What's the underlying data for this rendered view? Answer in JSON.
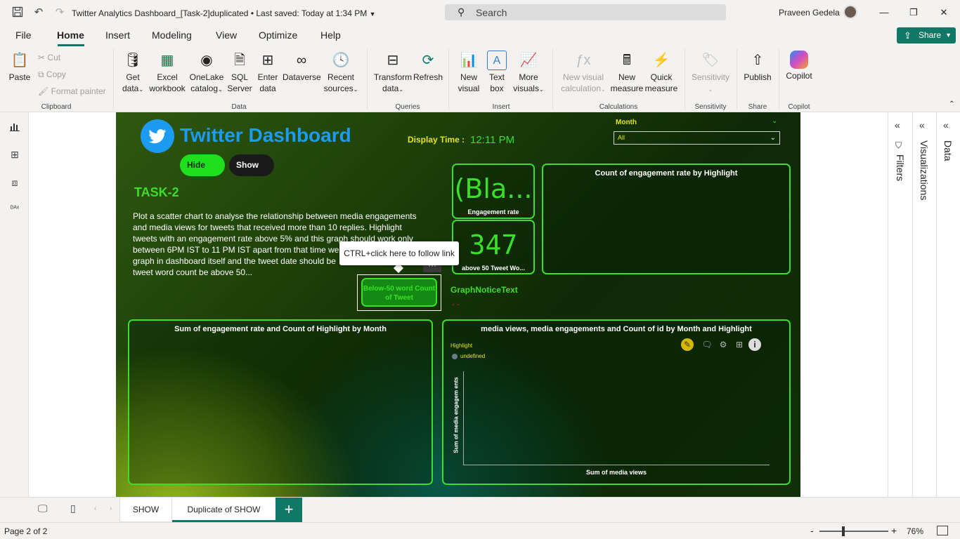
{
  "titlebar": {
    "doc_title": "Twitter Analytics Dashboard_[Task-2]duplicated",
    "saved_status": "• Last saved: Today at 1:34 PM",
    "search_placeholder": "Search",
    "user_name": "Praveen Gedela"
  },
  "ribbon_tabs": [
    "File",
    "Home",
    "Insert",
    "Modeling",
    "View",
    "Optimize",
    "Help"
  ],
  "share_label": "Share",
  "ribbon": {
    "paste": "Paste",
    "cut": "Cut",
    "copy": "Copy",
    "format_painter": "Format painter",
    "group_clipboard": "Clipboard",
    "get_data": [
      "Get",
      "data"
    ],
    "excel": [
      "Excel",
      "workbook"
    ],
    "onelake": [
      "OneLake",
      "catalog"
    ],
    "sql": [
      "SQL",
      "Server"
    ],
    "enter_data": [
      "Enter",
      "data"
    ],
    "dataverse": "Dataverse",
    "recent": [
      "Recent",
      "sources"
    ],
    "group_data": "Data",
    "transform": [
      "Transform",
      "data"
    ],
    "refresh": "Refresh",
    "group_queries": "Queries",
    "new_visual": [
      "New",
      "visual"
    ],
    "text_box": [
      "Text",
      "box"
    ],
    "more_visuals": [
      "More",
      "visuals"
    ],
    "group_insert": "Insert",
    "new_visual_calc": [
      "New visual",
      "calculation"
    ],
    "new_measure": [
      "New",
      "measure"
    ],
    "quick_measure": [
      "Quick",
      "measure"
    ],
    "group_calculations": "Calculations",
    "sensitivity": "Sensitivity",
    "group_sensitivity": "Sensitivity",
    "publish": "Publish",
    "group_share": "Share",
    "copilot": "Copilot",
    "group_copilot": "Copilot"
  },
  "report": {
    "title": "Twitter Dashboard",
    "hide_label": "Hide",
    "show_label": "Show",
    "task_title": "TASK-2",
    "task_description": "Plot a scatter chart to analyse the relationship between media engagements and media views for tweets that received more than 10 replies. Highlight tweets with an engagement rate above 5% and this graph should work only between 6PM IST to 11 PM IST apart from that time we",
    "task_description_line2": "graph in dashboard itself and the tweet date should be",
    "task_description_line3": "tweet word count be above 50...",
    "display_label": "Display Time :",
    "display_time": "12:11 PM",
    "month_label": "Month",
    "month_value": "All",
    "card1_value": "(Bla...",
    "card1_label": "Engagement rate",
    "card2_value": "347",
    "card2_label": "above 50 Tweet Wo...",
    "bar_title": "Count of engagement rate by Highlight",
    "below50_label": "Below-50 word Count of Tweet",
    "tooltip": "CTRL+click here to follow link",
    "more_label": "···",
    "notice_title": "GraphNoticeText",
    "notice_text": "- -",
    "line_title": "Sum of engagement rate and Count of Highlight by Month",
    "scatter_title": "media views, media engagements and Count of id by Month and Highlight",
    "legend_title": "Highlight",
    "legend_item": "undefined",
    "y_label": "Sum of media engagem ents",
    "x_label": "Sum of media views"
  },
  "panes": {
    "filters": "Filters",
    "visualizations": "Visualizations",
    "data": "Data"
  },
  "pages": {
    "tab1": "SHOW",
    "tab2": "Duplicate of SHOW"
  },
  "status": {
    "page_of": "Page 2 of 2",
    "zoom": "76%"
  },
  "colors": {
    "accent": "#117865",
    "neon_green": "#3bde2a",
    "twitter_blue": "#1d9bf0",
    "yellow": "#e6e60a"
  },
  "chart_data": {
    "type": "scatter",
    "title": "media views, media engagements and Count of id by Month and Highlight",
    "xlabel": "Sum of media views",
    "ylabel": "Sum of media engagem ents",
    "legend_title": "Highlight",
    "series": [
      {
        "name": "undefined",
        "x": [],
        "y": []
      }
    ]
  }
}
